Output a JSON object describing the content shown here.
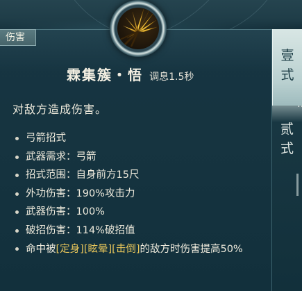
{
  "skill": {
    "category_tag": "伤害",
    "name": "霖集簇・悟",
    "cooldown": "调息1.5秒",
    "description": "对敌方造成伤害。",
    "icon": "golden-arrow-cluster-icon",
    "properties": [
      {
        "text": "弓箭招式"
      },
      {
        "text": "武器需求：弓箭"
      },
      {
        "text": "招式范围：自身前方15尺"
      },
      {
        "text": "外功伤害：190%攻击力"
      },
      {
        "text": "武器伤害：100%"
      },
      {
        "text": "破招伤害：114%破招值"
      }
    ],
    "last_property": {
      "prefix": "命中被",
      "keywords": [
        "[定身]",
        "[眩晕]",
        "[击倒]"
      ],
      "suffix": "的敌方时伤害提高50%"
    }
  },
  "tabs": [
    {
      "label_top": "壹",
      "label_bottom": "式",
      "active": true
    },
    {
      "label_top": "贰",
      "label_bottom": "式",
      "active": false
    }
  ],
  "side_mark": "…",
  "colors": {
    "panel": "#163440",
    "keyword": "#e8c65a",
    "text": "#eeeadc",
    "active_tab": "#c8dcdb"
  }
}
